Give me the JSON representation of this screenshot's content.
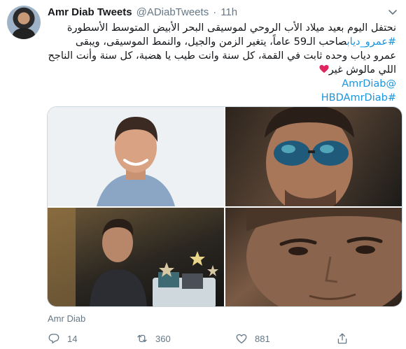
{
  "tweet": {
    "author_name": "Amr Diab Tweets",
    "handle": "@ADiabTweets",
    "separator": "·",
    "time": "11h",
    "text_lines": [
      "نحتفل اليوم بعيد ميلاد الأب الروحي لموسيقى البحر الأبيض المتوسط الأسطورة",
      "صاحب الـ59 عاماً، يتغير الزمن والجيل، والنمط الموسيقى، ويبقى",
      "عمرو دياب وحده ثابت في القمة، كل سنة وانت طيب يا هضبة، كل سنة وأنت الناجح",
      "اللي مالوش غير"
    ],
    "hashtag_inline": "#عمرو_دياب",
    "mention": "@AmrDiab",
    "hashtag_last": "#HBDAmrDiab",
    "media_caption": "Amr Diab"
  },
  "actions": {
    "replies": "14",
    "retweets": "360",
    "likes": "881"
  },
  "colors": {
    "link": "#1b95e0",
    "secondary_text": "#657786",
    "heart": "#e0245e"
  },
  "icons": [
    "chevron-down-icon",
    "reply-icon",
    "retweet-icon",
    "like-icon",
    "share-icon",
    "heart-emoji-icon"
  ]
}
